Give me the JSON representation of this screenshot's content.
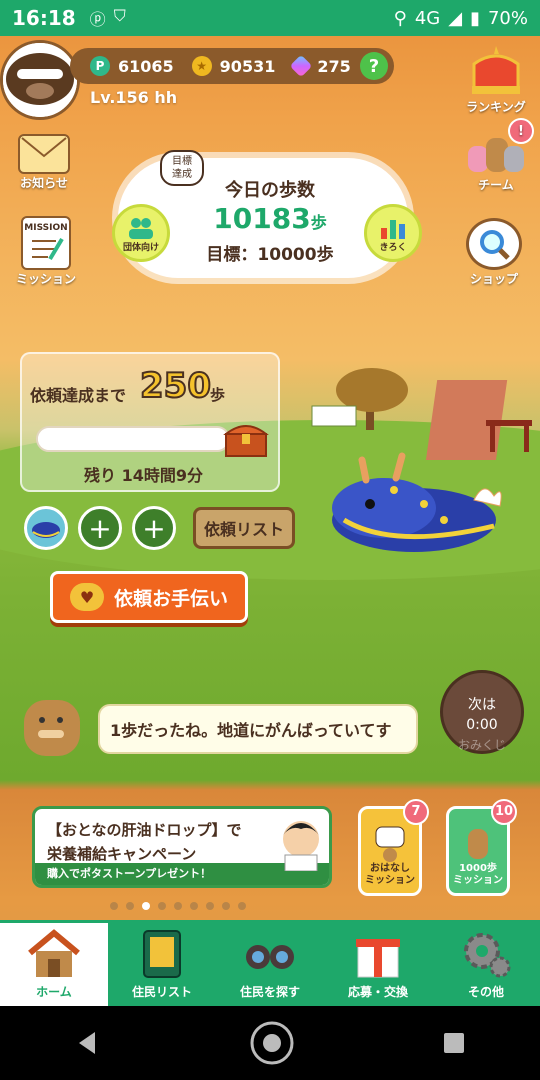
{
  "status_bar": {
    "time": "16:18",
    "network": "4G",
    "battery": "70%"
  },
  "profile": {
    "level": "Lv.156 hh"
  },
  "currencies": {
    "points": "61065",
    "coins": "90531",
    "gems": "275",
    "help": "?"
  },
  "side_left": [
    {
      "label": "お知らせ"
    },
    {
      "label": "ミッション",
      "badge_text": "MISSION"
    }
  ],
  "side_right": [
    {
      "label": "ランキング"
    },
    {
      "label": "チーム",
      "badge": "!"
    },
    {
      "label": "ショップ"
    }
  ],
  "steps": {
    "goal_badge": "目標\n達成",
    "title": "今日の歩数",
    "count": "10183",
    "unit": "歩",
    "goal": "目標：10000歩",
    "group_btn": "団体向け",
    "record_btn": "きろく"
  },
  "request": {
    "label": "依頼達成まで",
    "remaining_steps": "250",
    "unit": "歩",
    "remaining_time": "残り 14時間9分",
    "list_button": "依頼リスト",
    "help_button": "依頼お手伝い",
    "add_slot": "+"
  },
  "speech": {
    "text": "1歩だったね。地道にがんばっていてす"
  },
  "next_badge": {
    "line1": "次は",
    "line2": "0:00",
    "watermark": "おみくじ"
  },
  "banner": {
    "title": "【おとなの肝油ドロップ】で",
    "subtitle": "栄養補給キャンペーン",
    "strip": "購入でポタストーンプレゼント！"
  },
  "missions": [
    {
      "label": "おはなし\nミッション",
      "count": "7"
    },
    {
      "label": "1000歩\nミッション",
      "count": "10"
    }
  ],
  "carousel": {
    "total": 9,
    "active": 3
  },
  "bottom_nav": [
    {
      "label": "ホーム",
      "active": true
    },
    {
      "label": "住民リスト",
      "active": false
    },
    {
      "label": "住民を探す",
      "active": false
    },
    {
      "label": "応募・交換",
      "active": false
    },
    {
      "label": "その他",
      "active": false
    }
  ],
  "colors": {
    "primary_green": "#1ea86a",
    "brown": "#8b5a2b",
    "orange_button": "#f0651e",
    "sky_orange": "#e8903a",
    "grass": "#7cb135"
  }
}
